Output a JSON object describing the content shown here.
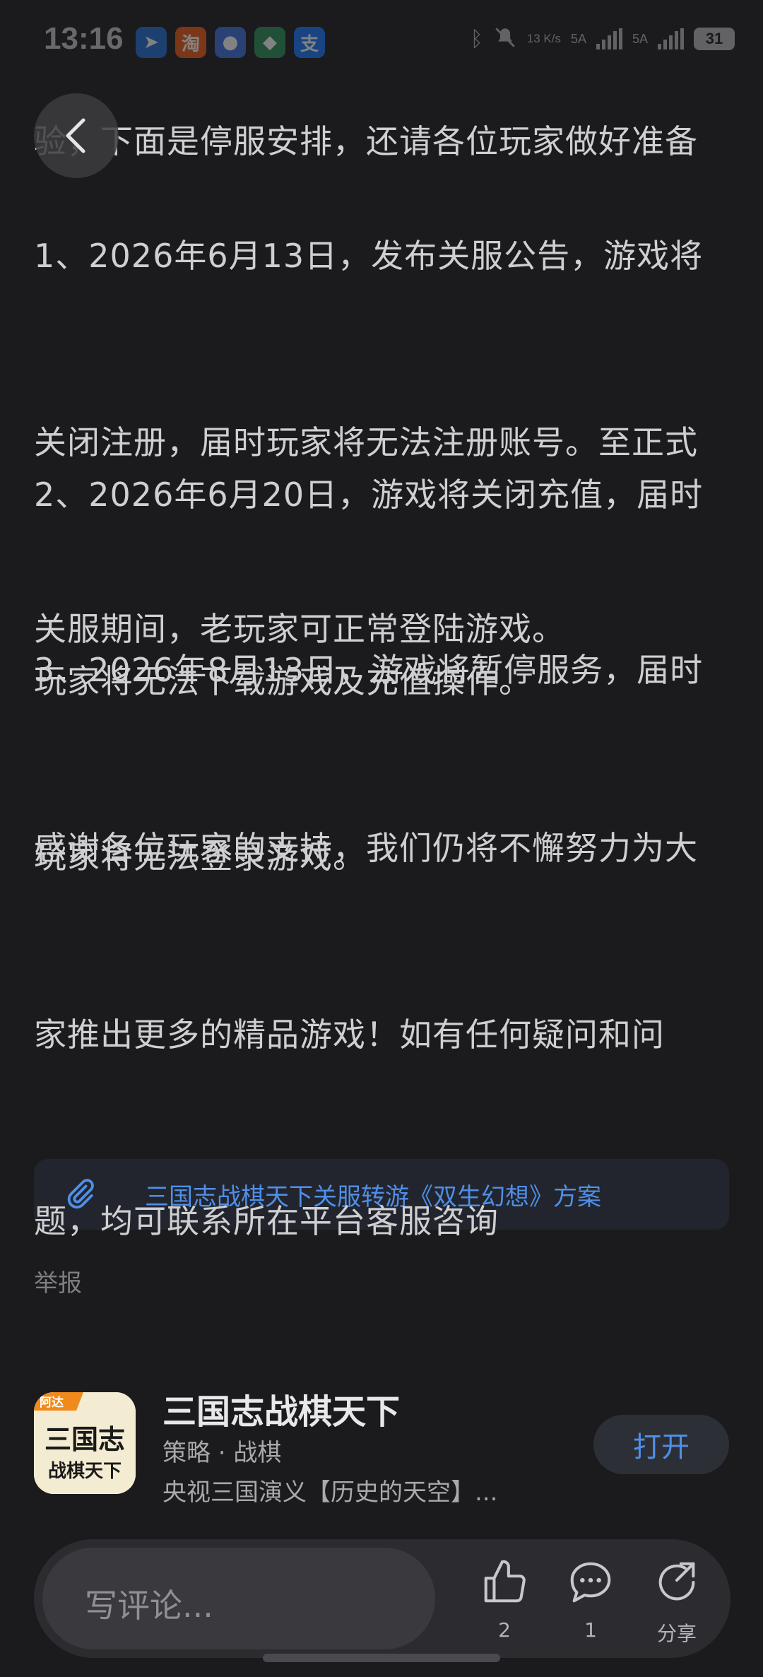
{
  "status_bar": {
    "time": "13:16",
    "net_speed": "13 K/s",
    "net1": "5A",
    "net2": "5A",
    "battery": "31",
    "app_icons": [
      {
        "name": "maps-icon",
        "color": "#1f6fd6",
        "glyph": "➤"
      },
      {
        "name": "taobao-icon",
        "color": "#f05a14",
        "glyph": "淘"
      },
      {
        "name": "message-icon",
        "color": "#3a6fe0",
        "glyph": "●"
      },
      {
        "name": "app-icon",
        "color": "#2a8f5a",
        "glyph": "◆"
      },
      {
        "name": "alipay-icon",
        "color": "#1677ff",
        "glyph": "支"
      }
    ]
  },
  "article": {
    "top_partial_line": "验，下面是停服安排，还请各位玩家做好准备",
    "para1": [
      "1、2026年6月13日，发布关服公告，游戏将",
      "关闭注册，届时玩家将无法注册账号。至正式",
      "关服期间，老玩家可正常登陆游戏。"
    ],
    "para2": [
      "2、2026年6月20日，游戏将关闭充值，届时",
      "玩家将无法下载游戏及充值操作。"
    ],
    "para3": [
      "3、2026年8月13日，游戏将暂停服务，届时",
      "玩家将无法登录游戏。"
    ],
    "para4": [
      "感谢各位玩家的支持，我们仍将不懈努力为大",
      "家推出更多的精品游戏！如有任何疑问和问",
      "题，均可联系所在平台客服咨询"
    ]
  },
  "attachment": {
    "text": "三国志战棋天下关服转游《双生幻想》方案"
  },
  "report_label": "举报",
  "app_card": {
    "title": "三国志战棋天下",
    "category": "策略 · 战棋",
    "description": "央视三国演义【历史的天空】...",
    "open_label": "打开",
    "icon_text_top": "三国志",
    "icon_text_bottom": "战棋天下",
    "icon_badge": "阿达"
  },
  "bottom_bar": {
    "comment_placeholder": "写评论...",
    "like_count": "2",
    "comment_count": "1",
    "share_label": "分享"
  },
  "colors": {
    "background": "#1b1b1d",
    "text": "#cfcfd2",
    "accent": "#4f8fe8"
  }
}
